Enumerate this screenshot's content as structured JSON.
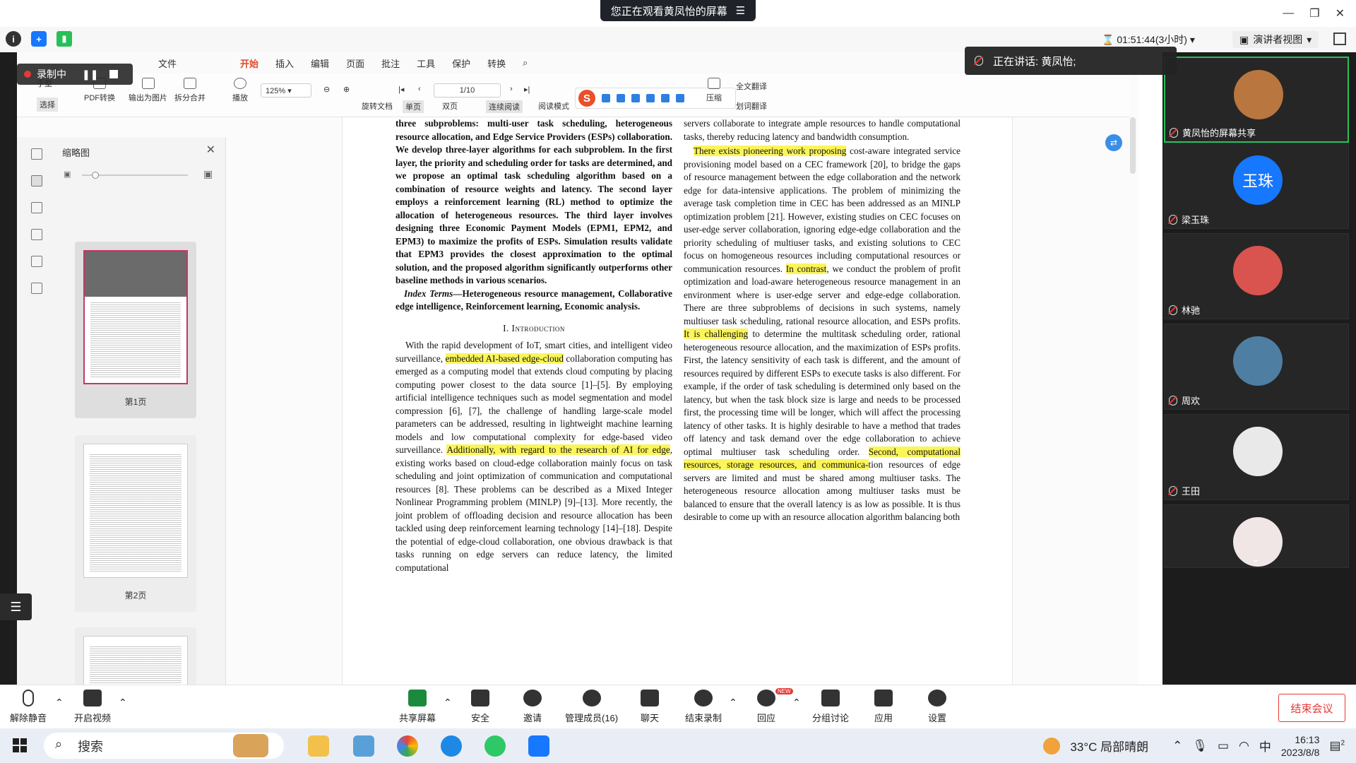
{
  "banner": {
    "text": "您正在观看黄凤怡的屏幕",
    "menu_icon": "list-icon"
  },
  "window": {
    "minimize": "—",
    "restore": "❐",
    "close": "✕"
  },
  "meeting_bar": {
    "timer": "01:51:44(3小时)",
    "speaker_view": "演讲者视图",
    "icons": [
      "info-icon",
      "shield-icon",
      "signal-icon"
    ]
  },
  "recording": {
    "label": "录制中"
  },
  "speaking": {
    "label": "正在讲话: 黄凤怡;"
  },
  "pdf": {
    "menu": [
      {
        "label": "文件",
        "active": false
      },
      {
        "label": "开始",
        "active": true
      },
      {
        "label": "插入",
        "active": false
      },
      {
        "label": "编辑",
        "active": false
      },
      {
        "label": "页面",
        "active": false
      },
      {
        "label": "批注",
        "active": false
      },
      {
        "label": "工具",
        "active": false
      },
      {
        "label": "保护",
        "active": false
      },
      {
        "label": "转换",
        "active": false
      }
    ],
    "toolbar": {
      "hand": "手型",
      "select": "选择",
      "pdf_convert": "PDF转换",
      "export_image": "输出为图片",
      "split_merge": "拆分合并",
      "play": "播放",
      "zoom": "125%",
      "page": "1/10",
      "rotate": "旋转文档",
      "single": "单页",
      "double": "双页",
      "continuous": "连续阅读",
      "reading_mode": "阅读模式",
      "compress": "压缩",
      "full_translate": "全文翻译",
      "word_translate": "划词翻译"
    },
    "thumbnails": {
      "title": "缩略图",
      "pages": [
        {
          "label": "第1页"
        },
        {
          "label": "第2页"
        },
        {
          "label": ""
        }
      ]
    },
    "document": {
      "abstract_lines": "three subproblems: multi-user task scheduling, heterogeneous resource allocation, and Edge Service Providers (ESPs) collaboration. We develop three-layer algorithms for each subproblem. In the first layer, the priority and scheduling order for tasks are determined, and we propose an optimal task scheduling algorithm based on a combination of resource weights and latency. The second layer employs a reinforcement learning (RL) method to optimize the allocation of heterogeneous resources. The third layer involves designing three Economic Payment Models (EPM1, EPM2, and EPM3) to maximize the profits of ESPs. Simulation results validate that EPM3 provides the closest approximation to the optimal solution, and the proposed algorithm significantly outperforms other baseline methods in various scenarios.",
      "index_terms_label": "Index Terms",
      "index_terms": "—Heterogeneous resource management, Collaborative edge intelligence, Reinforcement learning, Economic analysis.",
      "section_heading": "I. Introduction",
      "intro_p1_a": "With the rapid development of IoT, smart cities, and intelligent video surveillance, ",
      "intro_p1_hl1": "embedded AI-based edge-cloud",
      "intro_p1_b": " collaboration computing has emerged as a computing model that extends cloud computing by placing computing power closest to the data source [1]–[5]. By employing artificial intelligence techniques such as model segmentation and model compression [6], [7], the challenge of handling large-scale model parameters can be addressed, resulting in lightweight machine learning models and low computational complexity for edge-based video surveillance. ",
      "intro_p1_hl2": "Additionally, with regard to the research of AI for edge",
      "intro_p1_c": ", existing works based on cloud-edge collaboration mainly focus on task scheduling and joint optimization of communication and computational resources [8]. These problems can be described as a Mixed Integer Nonlinear Programming problem (MINLP) [9]–[13]. More recently, the joint problem of offloading decision and resource allocation has been tackled using deep reinforcement learning technology [14]–[18]. Despite the potential of edge-cloud collaboration, one obvious drawback is that tasks running on edge servers can reduce latency, the limited computational",
      "right_p0": "servers collaborate to integrate ample resources to handle computational tasks, thereby reducing latency and bandwidth consumption.",
      "right_hl1": "There exists pioneering work proposing",
      "right_p1": " cost-aware integrated service provisioning model based on a CEC framework [20], to bridge the gaps of resource management between the edge collaboration and the network edge for data-intensive applications. The problem of minimizing the average task completion time in CEC has been addressed as an MINLP optimization problem [21]. However, existing studies on CEC focuses on user-edge server collaboration, ignoring edge-edge collaboration and the priority scheduling of multiuser tasks, and existing solutions to CEC focus on homogeneous resources including computational resources or communication resources. ",
      "right_hl2": "In contrast",
      "right_p2": ", we conduct the problem of profit optimization and load-aware heterogeneous resource management in an environment where is user-edge server and edge-edge collaboration. There are three subproblems of decisions in such systems, namely multiuser task scheduling, rational resource allocation, and ESPs profits. ",
      "right_hl3": "It is challenging",
      "right_p3": " to determine the multitask scheduling order, rational heterogeneous resource allocation, and the maximization of ESPs profits. First, the latency sensitivity of each task is different, and the amount of resources required by different ESPs to execute tasks is also different. For example, if the order of task scheduling is determined only based on the latency, but when the task block size is large and needs to be processed first, the processing time will be longer, which will affect the processing latency of other tasks. It is highly desirable to have a method that trades off latency and task demand over the edge collaboration to achieve optimal multiuser task scheduling order. ",
      "right_hl4": "Second, computational resources, storage resources, and communica-",
      "right_p4": "tion resources of edge servers are limited and must be shared among multiuser tasks. The heterogeneous resource allocation among multiuser tasks must be balanced to ensure that the overall latency is as low as possible. It is thus desirable to come up with an resource allocation algorithm balancing both"
    }
  },
  "participants": [
    {
      "name": "黄凤怡的屏幕共享",
      "avatar_text": "",
      "color": "#b9763f",
      "active": true
    },
    {
      "name": "梁玉珠",
      "avatar_text": "玉珠",
      "color": "#1677ff",
      "active": false
    },
    {
      "name": "林驰",
      "avatar_text": "",
      "color": "#d9534f",
      "active": false
    },
    {
      "name": "周欢",
      "avatar_text": "",
      "color": "#4f7ea3",
      "active": false
    },
    {
      "name": "王田",
      "avatar_text": "",
      "color": "#e9e9e9",
      "active": false
    },
    {
      "name": "",
      "avatar_text": "",
      "color": "#f0e6e6",
      "active": false
    }
  ],
  "controls": {
    "unmute": "解除静音",
    "start_video": "开启视频",
    "share_screen": "共享屏幕",
    "security": "安全",
    "invite": "邀请",
    "manage_members": "管理成员(16)",
    "chat": "聊天",
    "end_recording": "结束录制",
    "react": "回应",
    "react_badge": "NEW",
    "breakout": "分组讨论",
    "apps": "应用",
    "settings": "设置",
    "end_meeting": "结束会议"
  },
  "taskbar": {
    "search": "搜索",
    "weather": "33°C  局部晴朗",
    "ime": "中",
    "time": "16:13",
    "date": "2023/8/8",
    "notifications": "2"
  }
}
